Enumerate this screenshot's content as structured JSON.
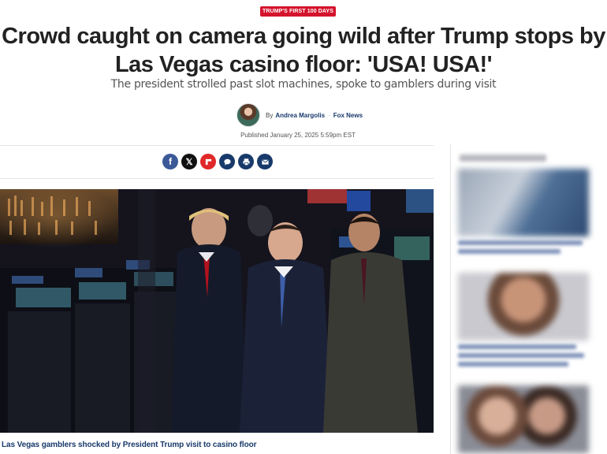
{
  "section_tag": "TRUMP'S FIRST 100 DAYS",
  "headline_line1": "Crowd caught on camera going wild after Trump stops by",
  "headline_line2": "Las Vegas casino floor: 'USA! USA!'",
  "subheadline": "The president strolled past slot machines, spoke to gamblers during visit",
  "byline": {
    "prefix": "By",
    "author": "Andrea Margolis",
    "separator": "·",
    "outlet": "Fox News"
  },
  "published": "Published January 25, 2025 5:59pm EST",
  "share_buttons": [
    {
      "name": "facebook-share-button",
      "icon": "facebook-icon",
      "color": "#3b5998"
    },
    {
      "name": "x-share-button",
      "icon": "x-icon",
      "color": "#111111"
    },
    {
      "name": "flipboard-share-button",
      "icon": "flipboard-icon",
      "color": "#e12828"
    },
    {
      "name": "comments-button",
      "icon": "comment-icon",
      "color": "#183a6b"
    },
    {
      "name": "print-button",
      "icon": "print-icon",
      "color": "#183a6b"
    },
    {
      "name": "email-share-button",
      "icon": "email-icon",
      "color": "#183a6b"
    }
  ],
  "hero_caption": "Las Vegas gamblers shocked by President Trump visit to casino floor",
  "colors": {
    "tag_red": "#d4132c",
    "link_navy": "#183a6b",
    "headline": "#222222"
  }
}
